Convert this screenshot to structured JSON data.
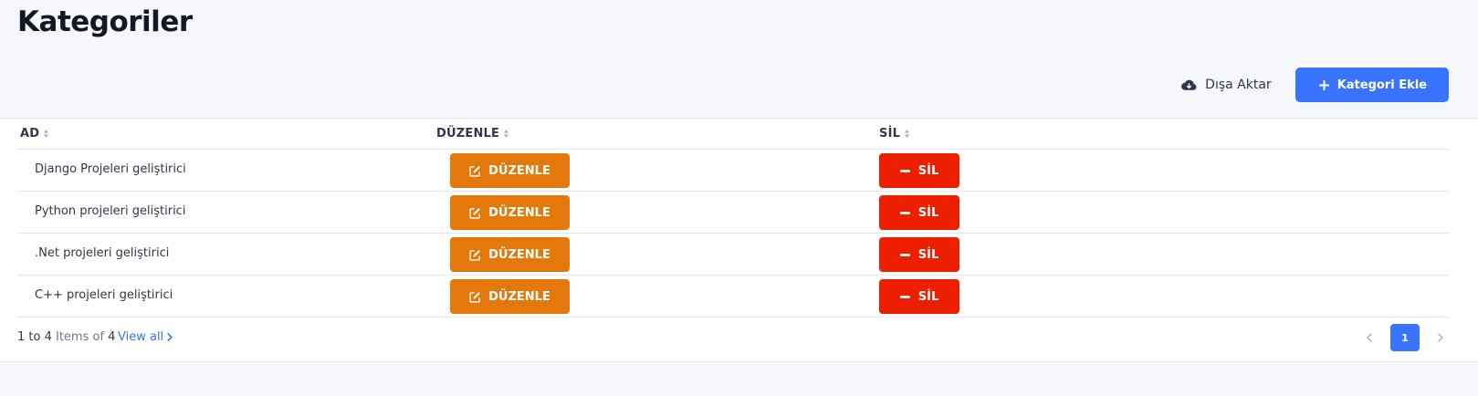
{
  "page": {
    "title": "Kategoriler"
  },
  "toolbar": {
    "export_label": "Dışa Aktar",
    "export_icon": "cloud-download-icon",
    "add_label": "Kategori Ekle",
    "add_icon": "plus-icon"
  },
  "table": {
    "columns": [
      "AD",
      "DÜZENLE",
      "SİL"
    ],
    "rows": [
      {
        "name": "Django Projeleri geliştirici",
        "edit_label": "DÜZENLE",
        "delete_label": "SİL"
      },
      {
        "name": "Python projeleri geliştirici",
        "edit_label": "DÜZENLE",
        "delete_label": "SİL"
      },
      {
        "name": ".Net projeleri geliştirici",
        "edit_label": "DÜZENLE",
        "delete_label": "SİL"
      },
      {
        "name": "C++ projeleri geliştirici",
        "edit_label": "DÜZENLE",
        "delete_label": "SİL"
      }
    ]
  },
  "footer": {
    "range": "1 to 4",
    "items_text": "Items of",
    "total": "4",
    "view_all": "View all",
    "current_page": "1"
  },
  "colors": {
    "primary": "#3874ff",
    "edit": "#e5780b",
    "delete": "#ec1f00",
    "background": "#f5f7fa"
  }
}
